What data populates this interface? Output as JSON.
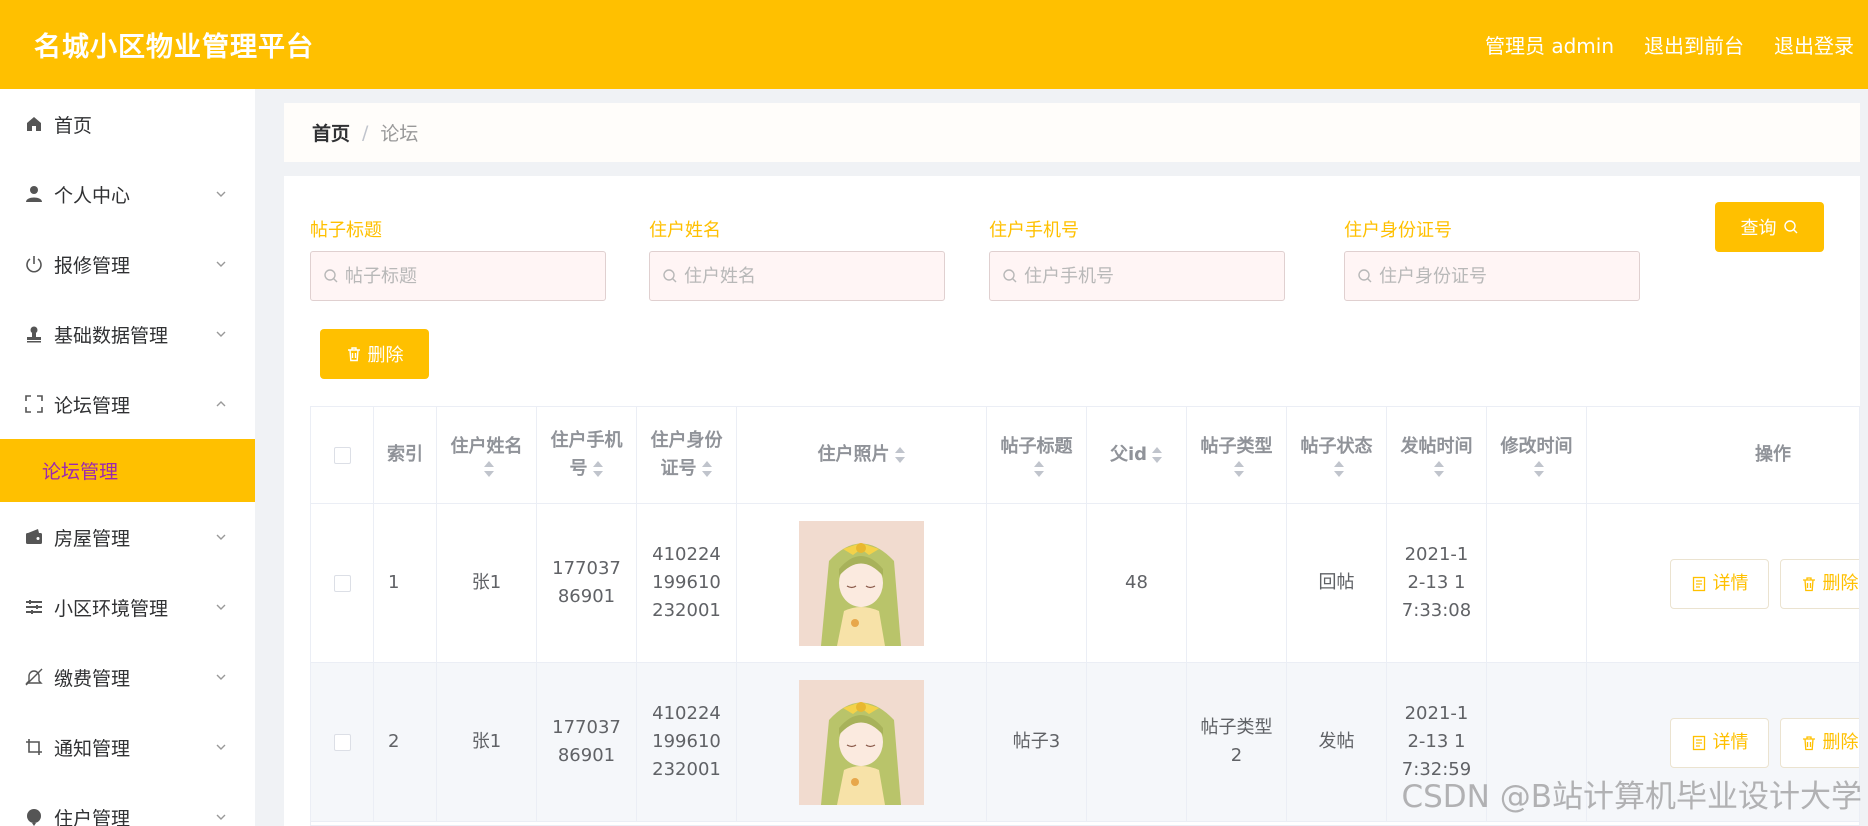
{
  "header": {
    "title": "名城小区物业管理平台",
    "admin_label": "管理员 admin",
    "front_link": "退出到前台",
    "logout_link": "退出登录"
  },
  "sidebar": {
    "items": [
      {
        "label": "首页",
        "icon": "home-icon"
      },
      {
        "label": "个人中心",
        "icon": "user-icon"
      },
      {
        "label": "报修管理",
        "icon": "power-icon"
      },
      {
        "label": "基础数据管理",
        "icon": "stamp-icon"
      },
      {
        "label": "论坛管理",
        "icon": "full-screen-icon"
      },
      {
        "label": "房屋管理",
        "icon": "wallet-icon"
      },
      {
        "label": "小区环境管理",
        "icon": "list-icon"
      },
      {
        "label": "缴费管理",
        "icon": "bell-off-icon"
      },
      {
        "label": "通知管理",
        "icon": "crop-icon"
      },
      {
        "label": "住户管理",
        "icon": "balloon-icon"
      }
    ],
    "active_sub": "论坛管理"
  },
  "breadcrumb": {
    "home": "首页",
    "separator": "/",
    "current": "论坛"
  },
  "filters": [
    {
      "label": "帖子标题",
      "placeholder": "帖子标题"
    },
    {
      "label": "住户姓名",
      "placeholder": "住户姓名"
    },
    {
      "label": "住户手机号",
      "placeholder": "住户手机号"
    },
    {
      "label": "住户身份证号",
      "placeholder": "住户身份证号"
    }
  ],
  "buttons": {
    "search": "查询",
    "delete": "删除"
  },
  "table": {
    "headers": [
      "索引",
      "住户姓名",
      "住户手机号",
      "住户身份证号",
      "住户照片",
      "帖子标题",
      "父id",
      "帖子类型",
      "帖子状态",
      "发帖时间",
      "修改时间",
      "操作"
    ],
    "rows": [
      {
        "index": "1",
        "name": "张1",
        "phone": "17703786901",
        "id_card": "410224199610232001",
        "title": "",
        "parent_id": "48",
        "type": "",
        "status": "回帖",
        "post_time": "2021-12-13 17:33:08",
        "update_time": ""
      },
      {
        "index": "2",
        "name": "张1",
        "phone": "17703786901",
        "id_card": "410224199610232001",
        "title": "帖子3",
        "parent_id": "",
        "type": "帖子类型2",
        "status": "发帖",
        "post_time": "2021-12-13 17:32:59",
        "update_time": ""
      }
    ],
    "row_actions": {
      "detail": "详情",
      "delete": "删除"
    }
  },
  "watermark": "CSDN @B站计算机毕业设计大学",
  "colors": {
    "accent": "#ffc000",
    "active_sub_text": "#9c27b0"
  }
}
